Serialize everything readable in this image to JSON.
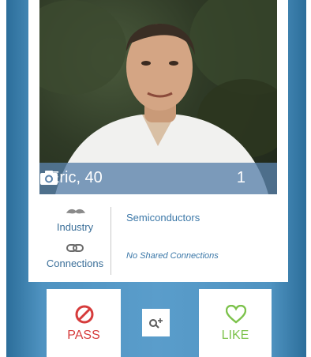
{
  "profile": {
    "name_age": "Eric, 40",
    "photo_count": "1"
  },
  "details": {
    "industry_label": "Industry",
    "industry_value": "Semiconductors",
    "connections_label": "Connections",
    "connections_value": "No Shared Connections"
  },
  "actions": {
    "pass_label": "PASS",
    "like_label": "LIKE"
  },
  "colors": {
    "pass": "#d63b3b",
    "like": "#7cc24b",
    "accent": "#3c78a8"
  },
  "icons": [
    "camera-icon",
    "mustache-icon",
    "link-icon",
    "pass-icon",
    "introduce-icon",
    "heart-icon"
  ]
}
